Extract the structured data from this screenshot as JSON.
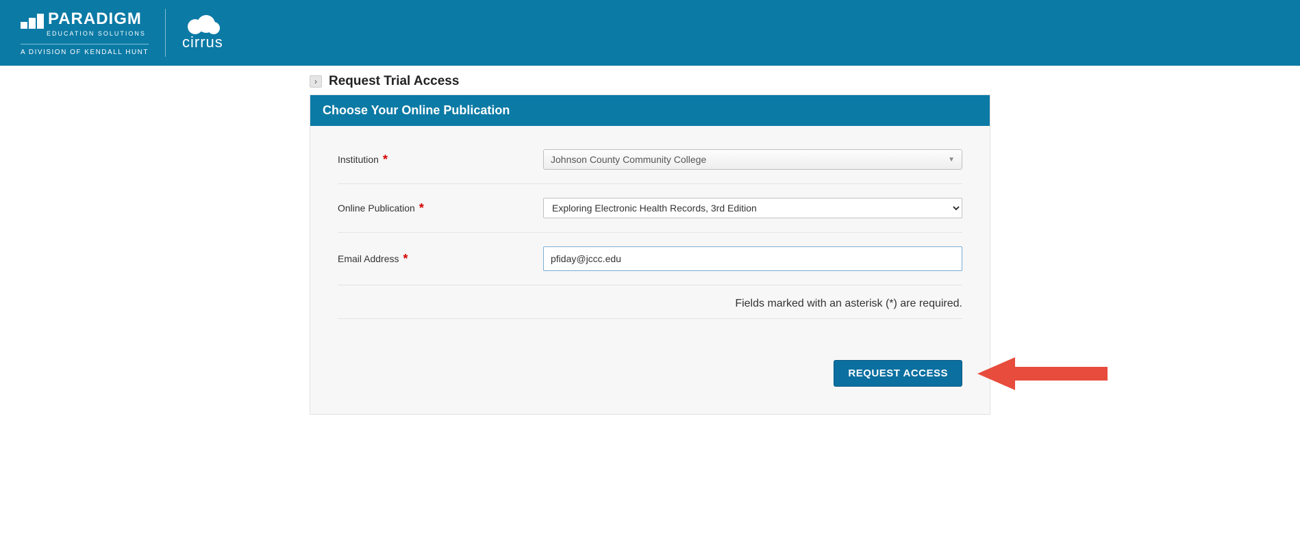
{
  "header": {
    "brand1_name": "PARADIGM",
    "brand1_sub": "EDUCATION SOLUTIONS",
    "brand1_div": "A DIVISION OF KENDALL HUNT",
    "brand2_name": "cirrus"
  },
  "page": {
    "title": "Request Trial Access",
    "panel_title": "Choose Your Online Publication",
    "hint": "Fields marked with an asterisk (*) are required.",
    "submit_label": "REQUEST ACCESS"
  },
  "form": {
    "institution": {
      "label": "Institution",
      "value": "Johnson County Community College"
    },
    "publication": {
      "label": "Online Publication",
      "value": "Exploring Electronic Health Records, 3rd Edition"
    },
    "email": {
      "label": "Email Address",
      "value": "pfiday@jccc.edu"
    }
  },
  "colors": {
    "brand_bg": "#0b7aa5",
    "button_bg": "#0b6fa0",
    "arrow": "#e74c3c"
  }
}
